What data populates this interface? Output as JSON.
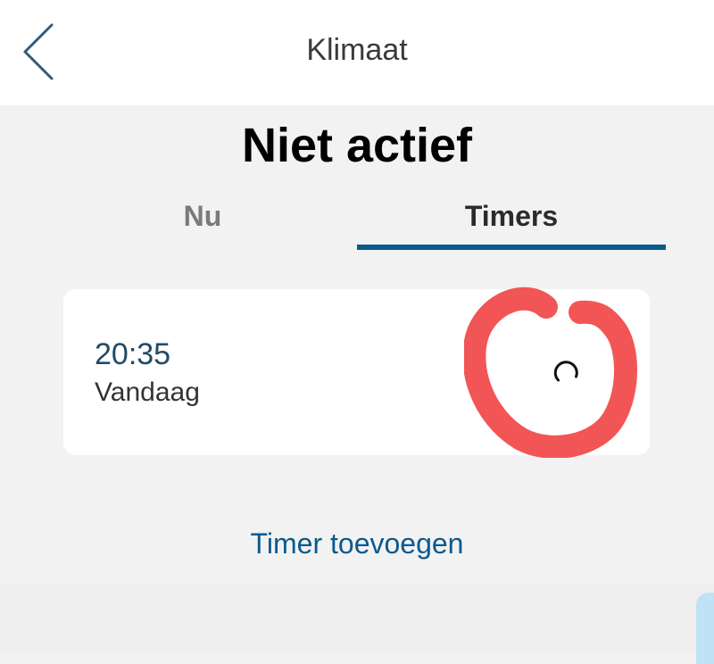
{
  "header": {
    "title": "Klimaat",
    "back_icon": "chevron-left-icon"
  },
  "status": {
    "title": "Niet actief"
  },
  "tabs": [
    {
      "label": "Nu",
      "active": false
    },
    {
      "label": "Timers",
      "active": true
    }
  ],
  "timer": {
    "time": "20:35",
    "day": "Vandaag",
    "status_icon": "loading-spinner-icon"
  },
  "actions": {
    "add_timer_label": "Timer toevoegen"
  },
  "colors": {
    "accent": "#0b5a8e",
    "annotation": "#f25555",
    "background": "#f2f2f2"
  }
}
